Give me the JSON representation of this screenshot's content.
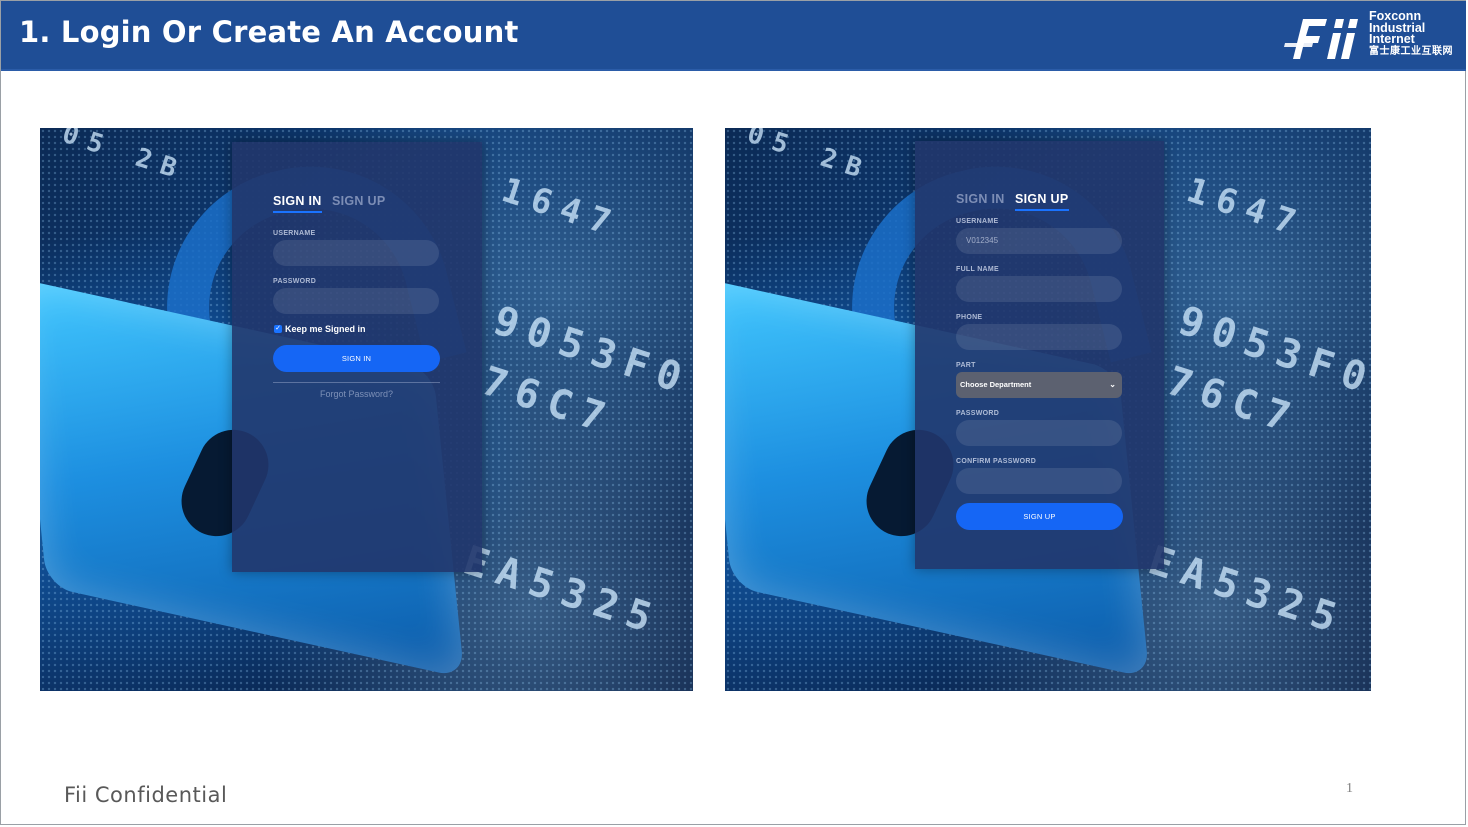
{
  "slide": {
    "title": "1. Login Or Create An Account",
    "footer": "Fii Confidential",
    "page_number": "1",
    "header_color": "#1f4e96"
  },
  "logo": {
    "mark_text": "Fii",
    "line1": "Foxconn",
    "line2": "Industrial",
    "line3": "Internet",
    "line4": "富士康工业互联网"
  },
  "signin_screen": {
    "tab_signin": "SIGN IN",
    "tab_signup": "SIGN UP",
    "username_label": "USERNAME",
    "password_label": "PASSWORD",
    "keep_signed_label": "Keep me Signed in",
    "keep_signed_checked": true,
    "signin_button": "SIGN IN",
    "forgot_link": "Forgot Password?"
  },
  "signup_screen": {
    "tab_signin": "SIGN IN",
    "tab_signup": "SIGN UP",
    "username_label": "USERNAME",
    "username_placeholder": "V012345",
    "fullname_label": "FULL NAME",
    "phone_label": "PHONE",
    "part_label": "PART",
    "part_selected": "Choose Department",
    "password_label": "PASSWORD",
    "confirm_password_label": "CONFIRM PASSWORD",
    "signup_button": "SIGN UP"
  },
  "colors": {
    "accent": "#1566f5",
    "card_bg": "#21366c"
  }
}
